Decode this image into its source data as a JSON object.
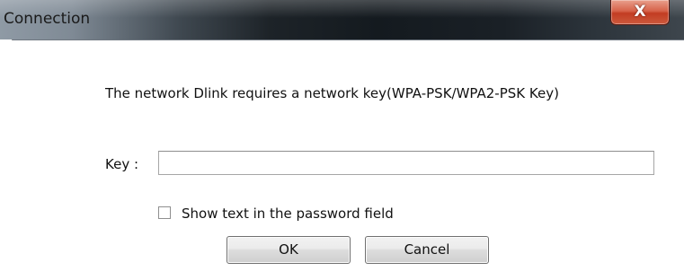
{
  "window": {
    "title": "Connection",
    "close_glyph": "X"
  },
  "dialog": {
    "message": "The network Dlink  requires a network key(WPA-PSK/WPA2-PSK Key)",
    "key_label": "Key :",
    "key_value": "",
    "show_password_label": "Show text in the password field",
    "show_password_checked": false,
    "ok_label": "OK",
    "cancel_label": "Cancel"
  }
}
